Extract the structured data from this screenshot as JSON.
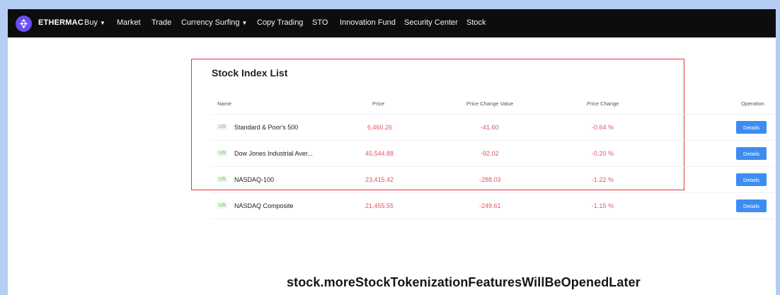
{
  "nav": {
    "brand": "ETHERMAC",
    "items": [
      {
        "label": "Buy",
        "dropdown": true
      },
      {
        "label": "Market",
        "dropdown": false
      },
      {
        "label": "Trade",
        "dropdown": false
      },
      {
        "label": "Currency Surfing",
        "dropdown": true
      },
      {
        "label": "Copy Trading",
        "dropdown": false
      },
      {
        "label": "STO",
        "dropdown": false
      },
      {
        "label": "Innovation Fund",
        "dropdown": false
      },
      {
        "label": "Security Center",
        "dropdown": false
      },
      {
        "label": "Stock",
        "dropdown": false
      }
    ],
    "caret": "▼"
  },
  "stock_list": {
    "title": "Stock Index List",
    "columns": {
      "name": "Name",
      "price": "Price",
      "change_value": "Price Change Value",
      "change_pct": "Price Change",
      "operation": "Operation"
    },
    "rows": [
      {
        "tag": "US",
        "name": "Standard & Poor's 500",
        "price": "6,460.26",
        "change_value": "-41.60",
        "change_pct": "-0.64 %",
        "action": "Details"
      },
      {
        "tag": "US",
        "name": "Dow Jones Industrial Aver...",
        "price": "45,544.88",
        "change_value": "-92.02",
        "change_pct": "-0.20 %",
        "action": "Details"
      },
      {
        "tag": "US",
        "name": "NASDAQ-100",
        "price": "23,415.42",
        "change_value": "-288.03",
        "change_pct": "-1.22 %",
        "action": "Details"
      },
      {
        "tag": "US",
        "name": "NASDAQ Composite",
        "price": "21,455.55",
        "change_value": "-249.61",
        "change_pct": "-1.15 %",
        "action": "Details"
      }
    ]
  },
  "footer_message": "stock.moreStockTokenizationFeaturesWillBeOpenedLater",
  "colors": {
    "accent": "#3d8cf2",
    "negative": "#e45563",
    "highlight": "#e0383e",
    "nav_bg": "#0d0d0d",
    "logo": "#6a4ef0",
    "tag": "#5cb85c"
  },
  "icons": {
    "logo": "ethermac-logo-icon"
  }
}
